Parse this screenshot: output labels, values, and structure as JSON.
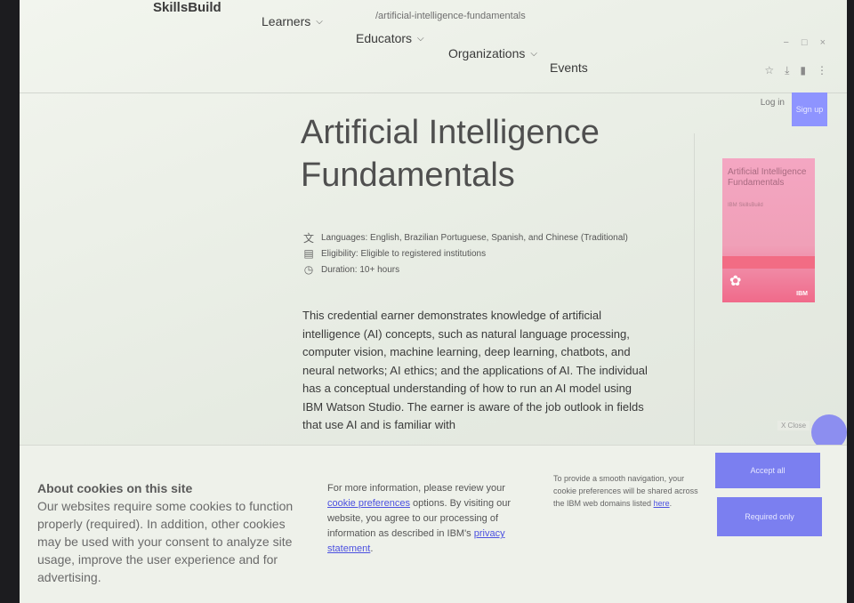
{
  "browser": {
    "url": "/artificial-intelligence-fundamentals",
    "controls": [
      "−",
      "□",
      "×"
    ],
    "toolbar_icons": [
      "☆",
      "⤓",
      "▮",
      "⋮"
    ]
  },
  "header": {
    "brand": "SkillsBuild",
    "nav": [
      {
        "label": "Learners"
      },
      {
        "label": "Educators"
      },
      {
        "label": "Organizations"
      },
      {
        "label": "Events"
      }
    ],
    "login_label": "Log in",
    "signup_label": "Sign up"
  },
  "course": {
    "title": "Artificial Intelligence Fundamentals",
    "languages": "Languages: English, Brazilian Portuguese, Spanish, and Chinese (Traditional)",
    "eligibility": "Eligibility: Eligible to registered institutions",
    "duration": "Duration: 10+ hours",
    "description": "This credential earner demonstrates knowledge of artificial intelligence (AI) concepts, such as natural language processing, computer vision, machine learning, deep learning, chatbots, and neural networks; AI ethics; and the applications of AI. The individual has a conceptual understanding of how to run an AI model using IBM Watson Studio. The earner is aware of the job outlook in fields that use AI and is familiar with",
    "thumbnail": {
      "title": "Artificial Intelligence Fundamentals",
      "sub": "IBM SkillsBuild",
      "logo": "IBM"
    }
  },
  "close_chip": "X Close",
  "cookie": {
    "heading": "About cookies on this site",
    "body": "Our websites require some cookies to function properly (required). In addition, other cookies may be used with your consent to analyze site usage, improve the user experience and for advertising.",
    "mid_before": "For more information, please review your",
    "mid_link1": "cookie preferences",
    "mid_middle": "options. By visiting our website, you agree to our processing of information as described in IBM's",
    "mid_link2": "privacy statement",
    "mid_end": ".",
    "right_before": "To provide a smooth navigation, your cookie preferences will be shared across the IBM web domains listed",
    "right_link": "here",
    "right_end": ".",
    "accept_label": "Accept all",
    "required_label": "Required only"
  },
  "colors": {
    "accent": "#7b7ff0",
    "thumb": "#f4a6c2"
  }
}
